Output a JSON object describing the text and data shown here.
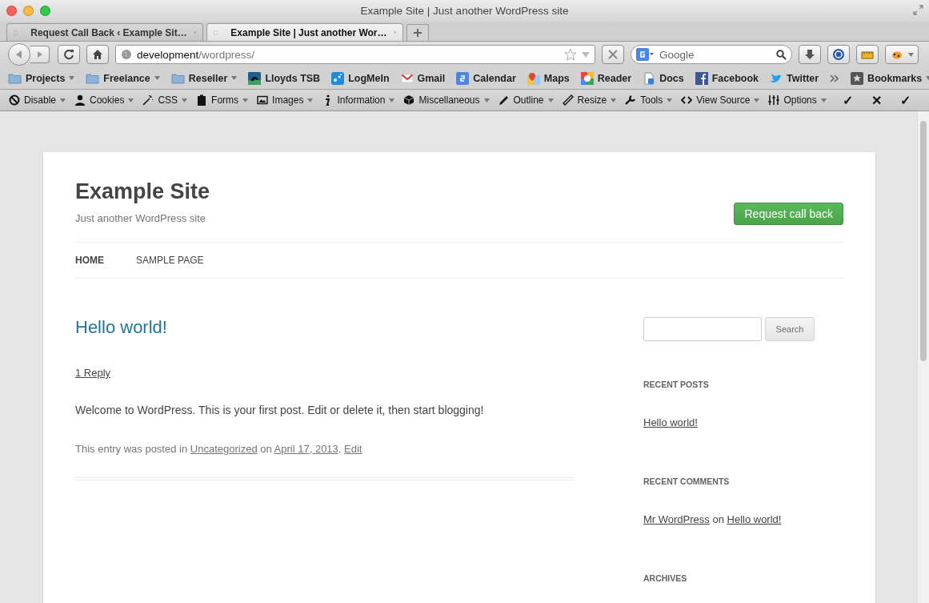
{
  "window": {
    "title": "Example Site | Just another WordPress site"
  },
  "tabs": [
    {
      "label": "Request Call Back ‹ Example Sit…",
      "selected": false
    },
    {
      "label": "Example Site | Just another Wor…",
      "selected": true
    }
  ],
  "address": {
    "host": "development",
    "path": "/wordpress/"
  },
  "search": {
    "placeholder": "Google"
  },
  "bookmarks": [
    {
      "label": "Projects",
      "kind": "folder"
    },
    {
      "label": "Freelance",
      "kind": "folder"
    },
    {
      "label": "Reseller",
      "kind": "folder"
    },
    {
      "label": "Lloyds TSB",
      "kind": "site"
    },
    {
      "label": "LogMeIn",
      "kind": "site"
    },
    {
      "label": "Gmail",
      "kind": "site"
    },
    {
      "label": "Calendar",
      "kind": "site"
    },
    {
      "label": "Maps",
      "kind": "site"
    },
    {
      "label": "Reader",
      "kind": "site"
    },
    {
      "label": "Docs",
      "kind": "site"
    },
    {
      "label": "Facebook",
      "kind": "site"
    },
    {
      "label": "Twitter",
      "kind": "site"
    }
  ],
  "bookmarks_menu": "Bookmarks",
  "dev_toolbar": {
    "items": [
      "Disable",
      "Cookies",
      "CSS",
      "Forms",
      "Images",
      "Information",
      "Miscellaneous",
      "Outline",
      "Resize",
      "Tools",
      "View Source",
      "Options"
    ],
    "marks": [
      "✓",
      "✕",
      "✓"
    ]
  },
  "site": {
    "title": "Example Site",
    "tagline": "Just another WordPress site",
    "cta": "Request call back",
    "nav": [
      {
        "label": "HOME",
        "selected": true
      },
      {
        "label": "SAMPLE PAGE",
        "selected": false
      }
    ]
  },
  "post": {
    "title": "Hello world!",
    "reply": "1 Reply",
    "body": "Welcome to WordPress. This is your first post. Edit or delete it, then start blogging!",
    "meta": [
      {
        "kind": "text",
        "text": "This entry was posted in "
      },
      {
        "kind": "link",
        "text": "Uncategorized"
      },
      {
        "kind": "text",
        "text": " on "
      },
      {
        "kind": "link",
        "text": "April 17, 2013"
      },
      {
        "kind": "text",
        "text": ". "
      },
      {
        "kind": "link",
        "text": "Edit"
      }
    ]
  },
  "sidebar": {
    "search_button": "Search",
    "widgets": [
      {
        "heading": "RECENT POSTS",
        "lines": [
          [
            {
              "kind": "link",
              "text": "Hello world!"
            }
          ]
        ]
      },
      {
        "heading": "RECENT COMMENTS",
        "lines": [
          [
            {
              "kind": "link",
              "text": "Mr WordPress"
            },
            {
              "kind": "text",
              "text": " on "
            },
            {
              "kind": "link",
              "text": "Hello world!"
            }
          ]
        ]
      },
      {
        "heading": "ARCHIVES"
      }
    ]
  }
}
